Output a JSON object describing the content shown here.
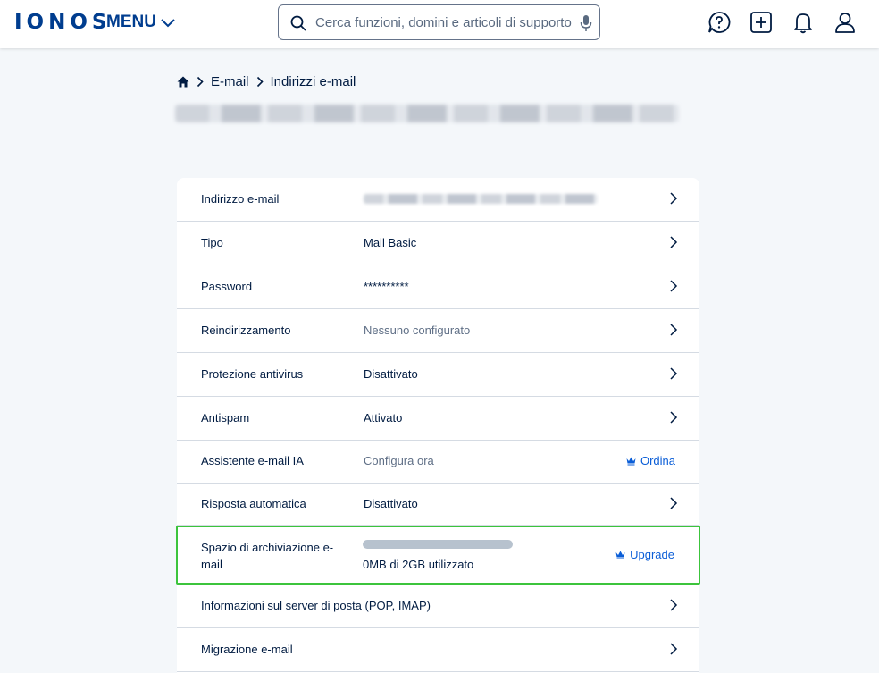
{
  "header": {
    "logo": "IONOS",
    "menu_label": "MENU",
    "search_placeholder": "Cerca funzioni, domini e articoli di supporto"
  },
  "breadcrumb": [
    "E-mail",
    "Indirizzi e-mail"
  ],
  "rows": [
    {
      "label": "Indirizzo e-mail",
      "value": ""
    },
    {
      "label": "Tipo",
      "value": "Mail Basic"
    },
    {
      "label": "Password",
      "value": "**********"
    },
    {
      "label": "Reindirizzamento",
      "value": "Nessuno configurato"
    },
    {
      "label": "Protezione antivirus",
      "value": "Disattivato"
    },
    {
      "label": "Antispam",
      "value": "Attivato"
    },
    {
      "label": "Assistente e-mail IA",
      "value": "Configura ora",
      "action": "Ordina"
    },
    {
      "label": "Risposta automatica",
      "value": "Disattivato"
    },
    {
      "label": "Spazio di archiviazione e-mail",
      "value": "0MB di 2GB utilizzato",
      "action": "Upgrade",
      "usage_fraction": 0
    },
    {
      "label": "Informazioni sul server di posta (POP, IMAP)",
      "value": ""
    },
    {
      "label": "Migrazione e-mail",
      "value": ""
    }
  ],
  "colors": {
    "brand": "#003d8f",
    "link": "#0b5ed7",
    "highlight": "#3cc43c",
    "background": "#f4f7fa"
  }
}
